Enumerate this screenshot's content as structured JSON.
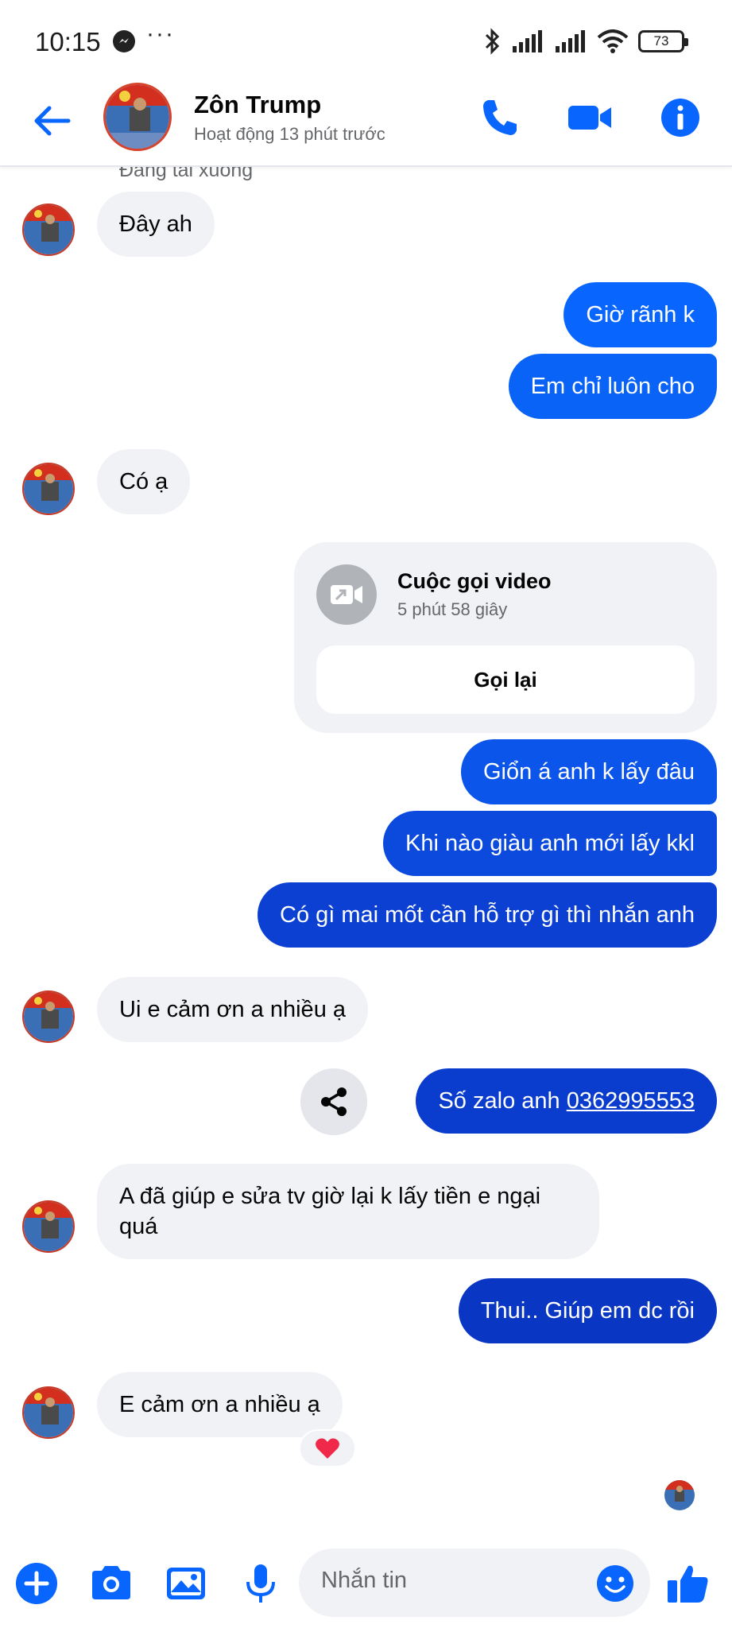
{
  "status_bar": {
    "time": "10:15",
    "more": "···",
    "battery": "73"
  },
  "header": {
    "name": "Zôn Trump",
    "status": "Hoạt động 13 phút trước"
  },
  "chat": {
    "loading_note": "Đang tải xuống",
    "messages": [
      {
        "from": "them",
        "text": "Đây ah"
      },
      {
        "from": "me",
        "text": "Giờ rãnh k"
      },
      {
        "from": "me",
        "text": "Em chỉ luôn cho"
      },
      {
        "from": "them",
        "text": "Có ạ"
      },
      {
        "from": "me",
        "text": "Giổn á anh k lấy đâu"
      },
      {
        "from": "me",
        "text": "Khi nào giàu anh mới lấy kkl"
      },
      {
        "from": "me",
        "text": "Có gì mai mốt cần hỗ trợ gì thì nhắn anh"
      },
      {
        "from": "them",
        "text": "Ui e cảm ơn a nhiều ạ"
      },
      {
        "from": "me",
        "text": "Số zalo anh ",
        "link": "0362995553"
      },
      {
        "from": "them",
        "text": "A đã giúp e sửa tv giờ lại k lấy tiền e ngại quá"
      },
      {
        "from": "me",
        "text": "Thui.. Giúp em dc rồi"
      },
      {
        "from": "them",
        "text": "E cảm ơn a nhiều ạ",
        "reaction": "heart"
      }
    ],
    "call": {
      "title": "Cuộc gọi video",
      "duration": "5 phút 58 giây",
      "button": "Gọi lại"
    }
  },
  "composer": {
    "placeholder": "Nhắn tin"
  },
  "colors": {
    "accent": "#0866ff",
    "out_bubble_top": "#0866ff",
    "out_bubble_bottom": "#0a34c9",
    "in_bubble": "#f0f2f5",
    "reaction_heart": "#f02849"
  }
}
